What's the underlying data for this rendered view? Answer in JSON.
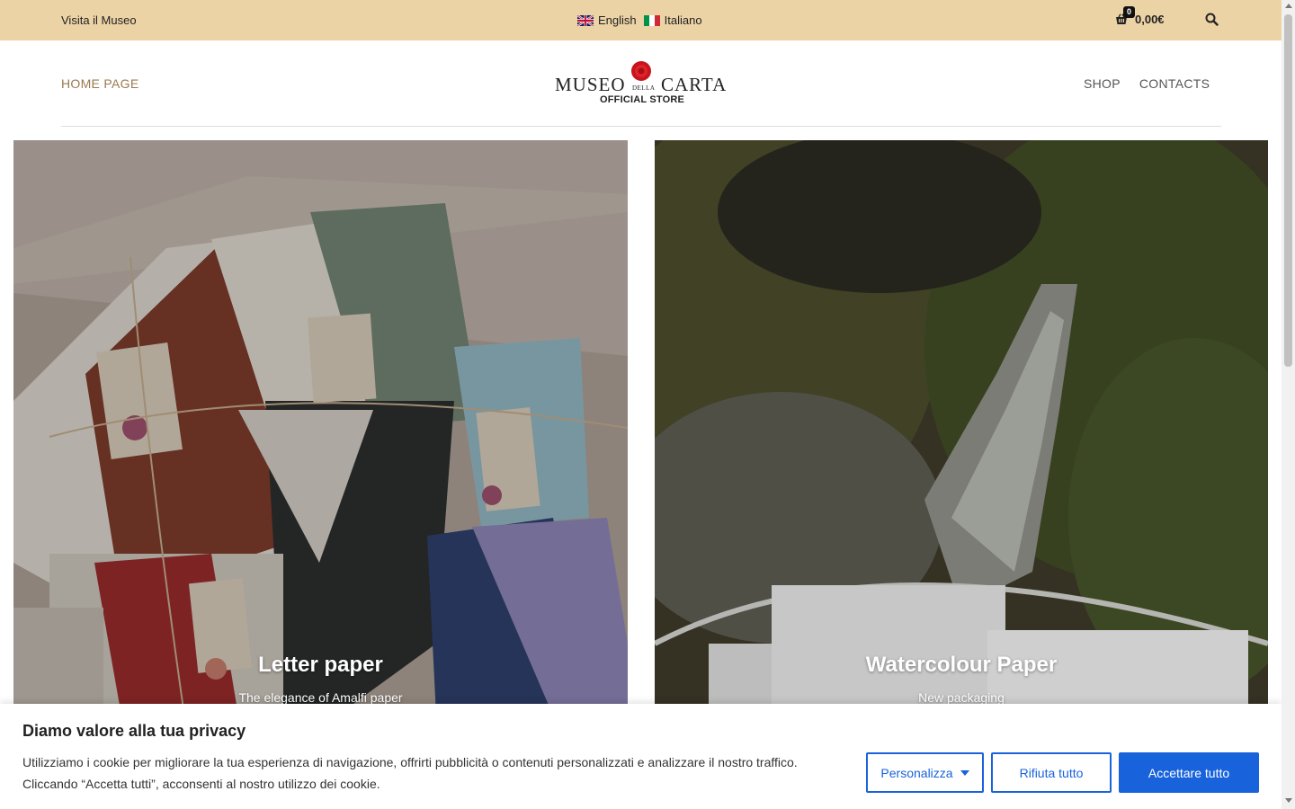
{
  "topbar": {
    "visit_label": "Visita il Museo",
    "languages": [
      {
        "label": "English",
        "flag": "uk-flag-icon"
      },
      {
        "label": "Italiano",
        "flag": "italy-flag-icon"
      }
    ],
    "cart": {
      "count": "0",
      "total": "0,00€",
      "icon": "basket-icon"
    },
    "search_icon": "search-icon"
  },
  "header": {
    "home_label": "HOME PAGE",
    "nav": [
      {
        "label": "SHOP"
      },
      {
        "label": "CONTACTS"
      }
    ],
    "logo": {
      "museo": "MUSEO",
      "della": "DELLA",
      "carta": "CARTA",
      "official": "OFFICIAL STORE"
    }
  },
  "cards": [
    {
      "title": "Letter paper",
      "subtitle": "The elegance of Amalfi paper"
    },
    {
      "title": "Watercolour Paper",
      "subtitle": "New packaging"
    }
  ],
  "cookie": {
    "title": "Diamo valore alla tua privacy",
    "text": "Utilizziamo i cookie per migliorare la tua esperienza di navigazione, offrirti pubblicità o contenuti personalizzati e analizzare il nostro traffico. Cliccando “Accetta tutti”, acconsenti al nostro utilizzo dei cookie.",
    "customize_label": "Personalizza",
    "reject_label": "Rifiuta tutto",
    "accept_label": "Accettare tutto"
  },
  "colors": {
    "topbar_bg": "#ecd3a6",
    "home_link": "#9a7a52",
    "accent_blue": "#1863dc"
  }
}
